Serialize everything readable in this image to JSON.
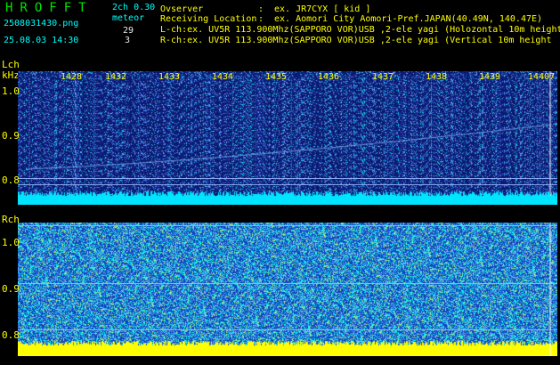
{
  "header": {
    "app_name": "HROFFT",
    "version": "2ch 0.30",
    "filename": "2508031430.png",
    "timestamp": "25.08.03 14:30",
    "meteor_label": "meteor",
    "lch_count": "29",
    "rch_count": "3",
    "observer_label": "Ovserver",
    "observer_value": "ex. JR7CYX [ kid ]",
    "location_label": "Receiving Location",
    "location_value": "ex. Aomori City Aomori-Pref.JAPAN(40.49N, 140.47E)",
    "lch_desc": "L-ch:ex. UV5R 113.900Mhz(SAPPORO VOR)USB ,2-ele yagi (Holozontal 10m height",
    "rch_desc": "R-ch:ex. UV5R 113.900Mhz(SAPPORO VOR)USB ,2-ele yagi (Vertical 10m height"
  },
  "lch": {
    "label": "Lch",
    "unit": "kHz",
    "y_ticks": [
      "1.0",
      "0.9",
      "0.8"
    ]
  },
  "rch": {
    "label": "Rch",
    "y_ticks": [
      "1.0",
      "0.9",
      "0.8"
    ]
  },
  "time_ticks": [
    "1428",
    "1432",
    "1433",
    "1434",
    "1435",
    "1436",
    "1437",
    "1438",
    "1439",
    "14407"
  ],
  "colors": {
    "background": "#000000",
    "lch_base": "#0a1a6e",
    "rch_base": "#1040c0",
    "noise_cyan": "#00ffff",
    "bottom_band_lch": "#00e5ff",
    "bottom_band_rch": "#ffff00",
    "label_yellow": "#ffff00",
    "title_green": "#00e600"
  }
}
